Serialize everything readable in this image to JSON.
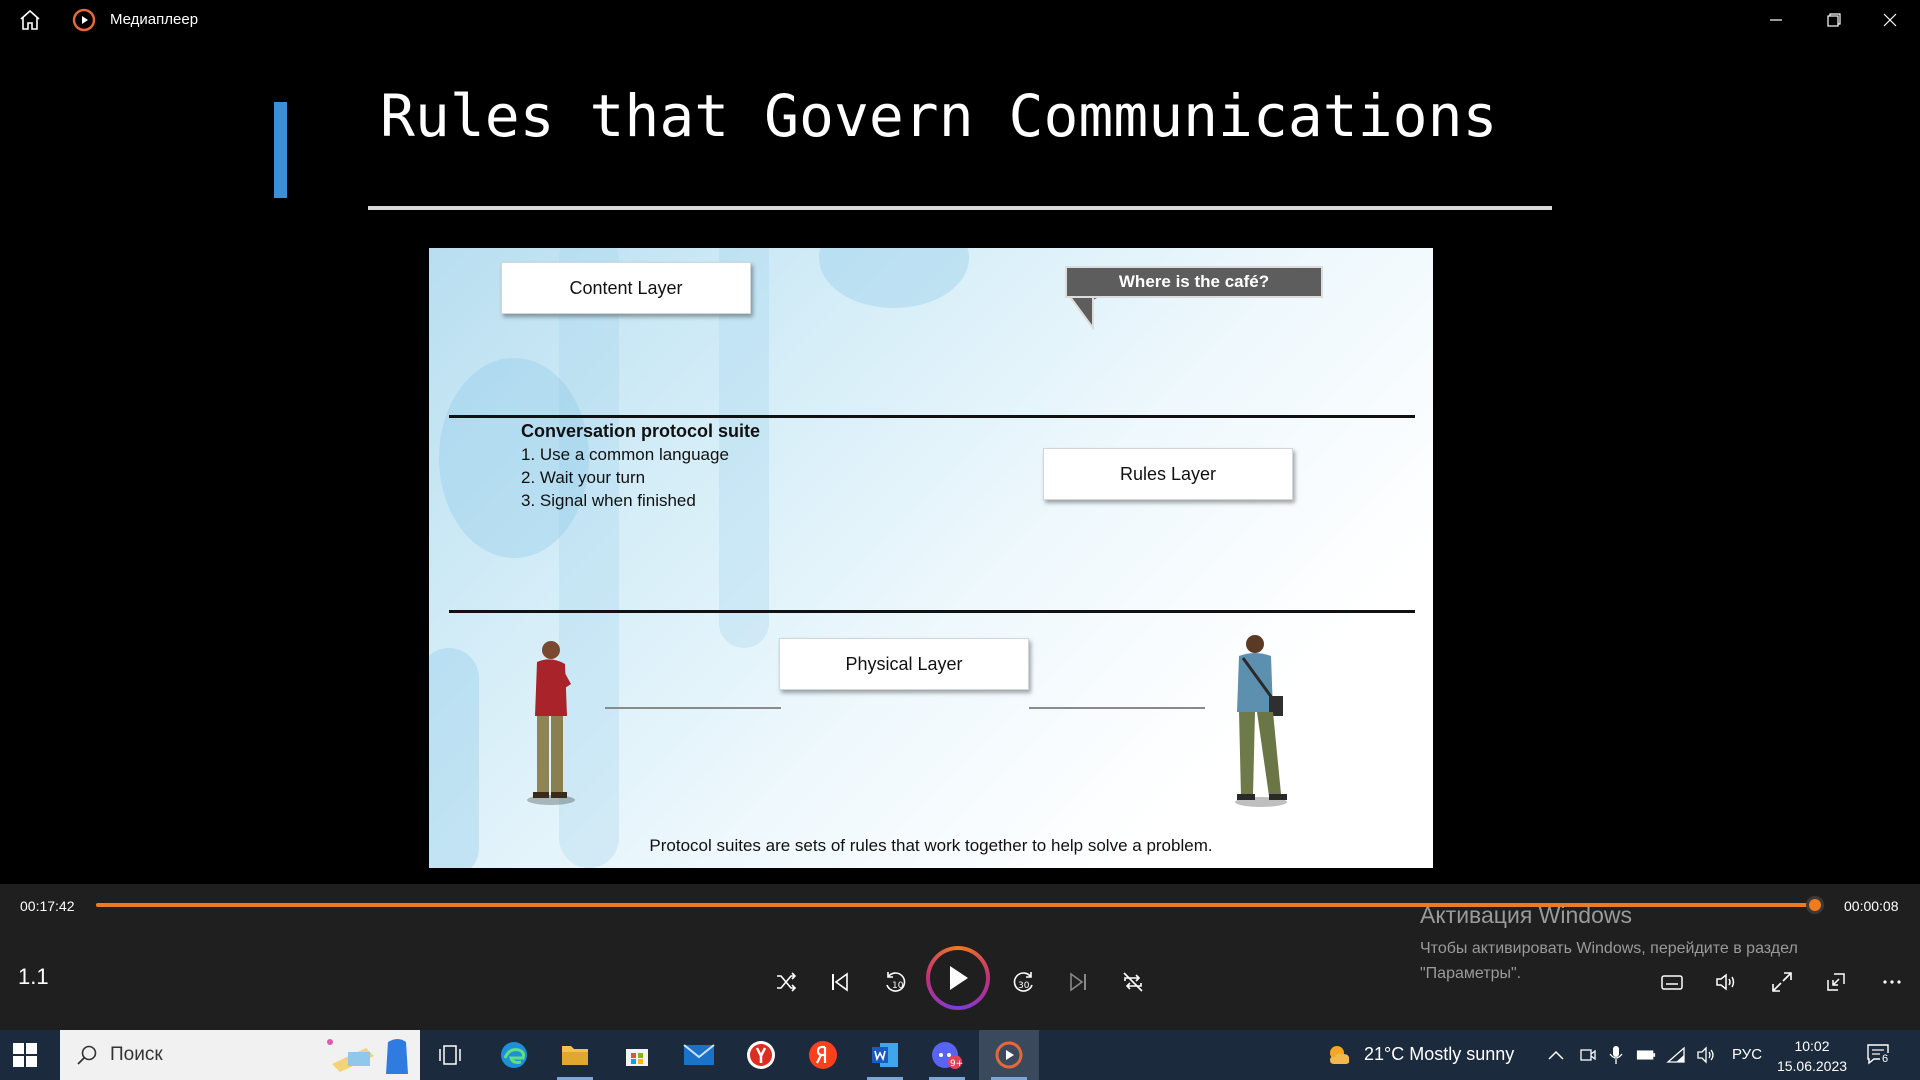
{
  "window": {
    "title": "Медиаплеер"
  },
  "slide": {
    "title": "Rules that Govern Communications",
    "figure": {
      "content_layer": "Content Layer",
      "speech": "Where is the café?",
      "protocol_heading": "Conversation protocol suite",
      "protocol_items": [
        "1. Use a common language",
        "2. Wait your turn",
        "3. Signal when finished"
      ],
      "rules_layer": "Rules Layer",
      "physical_layer": "Physical Layer",
      "caption": "Protocol suites are sets of rules that work together to help solve a problem."
    }
  },
  "player": {
    "elapsed": "00:17:42",
    "remaining": "00:00:08",
    "progress": 0.995,
    "speed": "1.1",
    "accent_color": "#f07a1c",
    "activation_title": "Активация Windows",
    "activation_text": "Чтобы активировать Windows, перейдите в раздел \"Параметры\"."
  },
  "taskbar": {
    "search_placeholder": "Поиск",
    "weather": "21°C  Mostly sunny",
    "language": "РУС",
    "time": "10:02",
    "date": "15.06.2023",
    "notification_count": "6",
    "apps": [
      "task-view",
      "edge",
      "file-explorer",
      "microsoft-store",
      "mail",
      "yandex-browser",
      "yandex",
      "word",
      "discord",
      "media-player"
    ]
  }
}
